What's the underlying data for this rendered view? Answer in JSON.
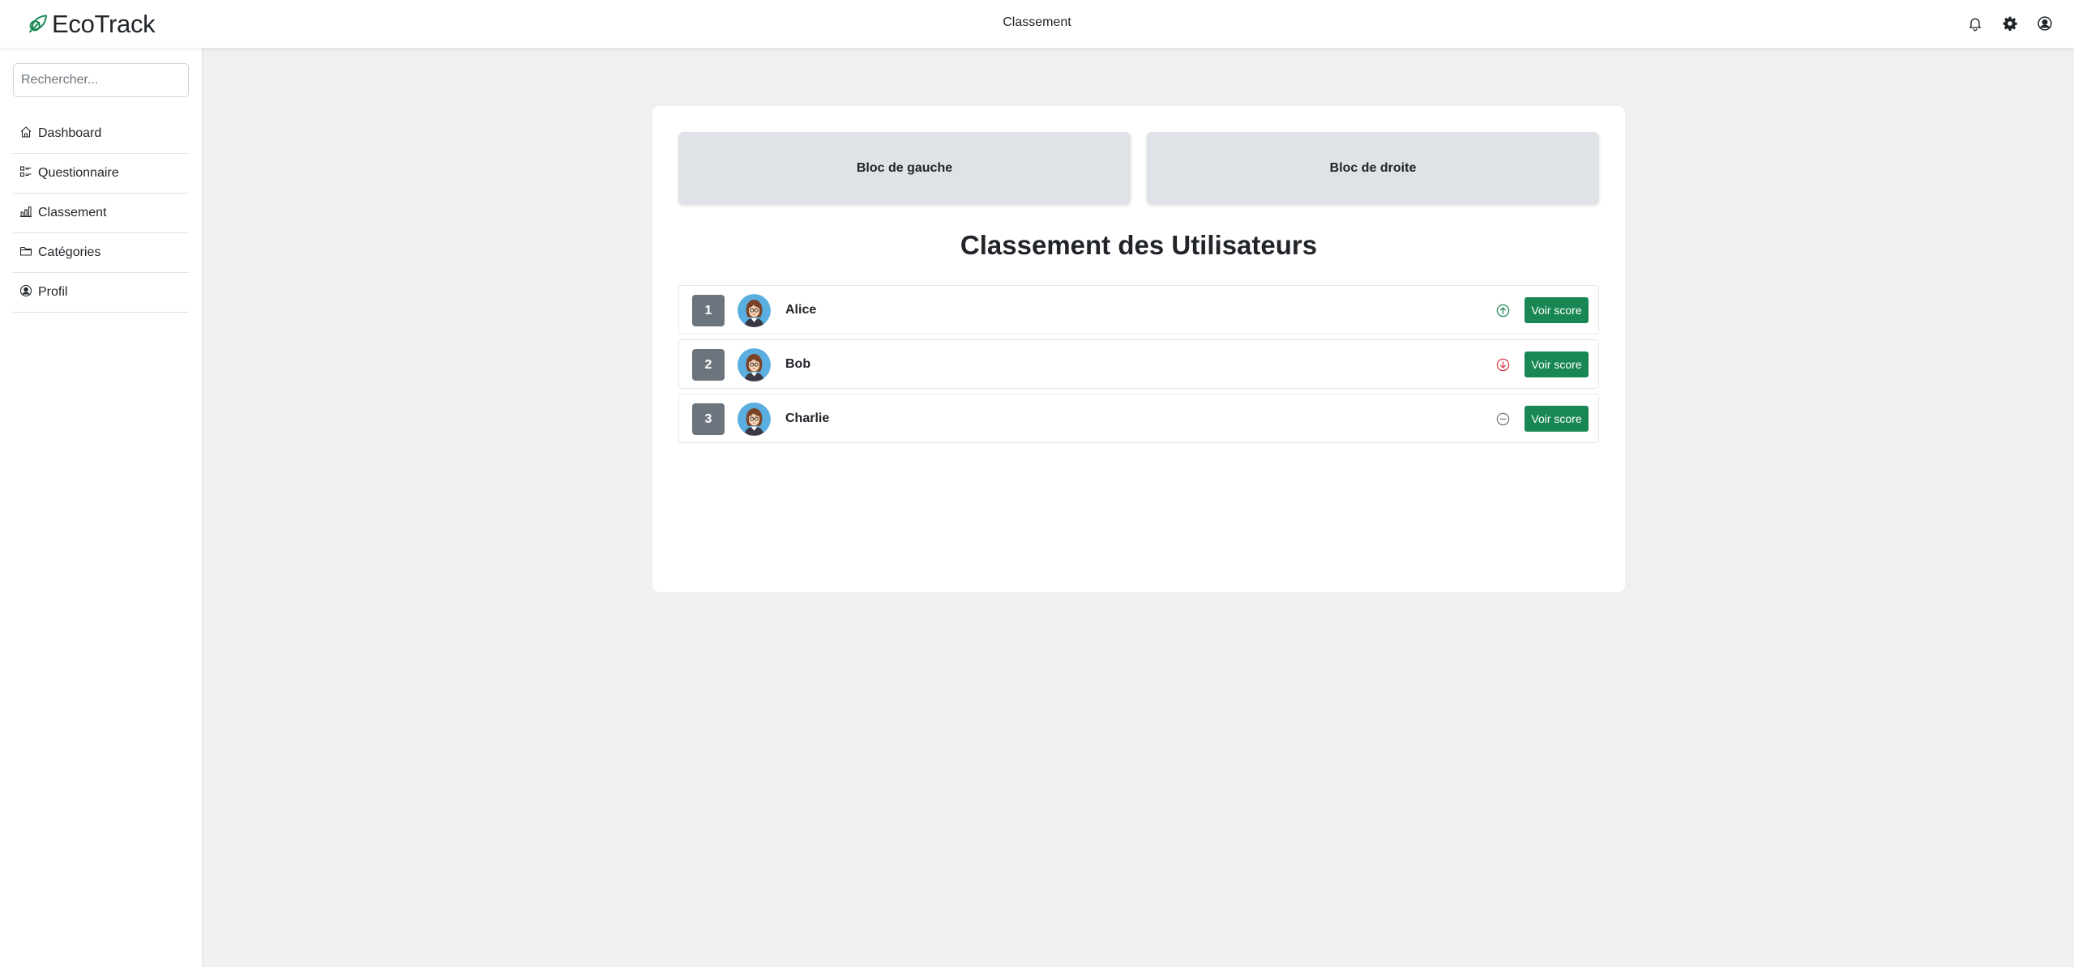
{
  "header": {
    "brand": "EcoTrack",
    "page_title": "Classement",
    "colors": {
      "brand_accent": "#198754"
    },
    "icons": [
      "leaf-icon",
      "bell-icon",
      "gear-icon",
      "user-circle-icon"
    ]
  },
  "sidebar": {
    "search_placeholder": "Rechercher...",
    "items": [
      {
        "label": "Dashboard",
        "icon": "house-icon"
      },
      {
        "label": "Questionnaire",
        "icon": "list-check-icon"
      },
      {
        "label": "Classement",
        "icon": "bar-chart-icon"
      },
      {
        "label": "Catégories",
        "icon": "folder-icon"
      },
      {
        "label": "Profil",
        "icon": "person-circle-icon"
      }
    ]
  },
  "main": {
    "left_block": "Bloc de gauche",
    "right_block": "Bloc de droite",
    "heading": "Classement des Utilisateurs",
    "ranking": [
      {
        "rank": "1",
        "name": "Alice",
        "trend": "up",
        "trend_color": "#198754",
        "button": "Voir score"
      },
      {
        "rank": "2",
        "name": "Bob",
        "trend": "down",
        "trend_color": "#dc3545",
        "button": "Voir score"
      },
      {
        "rank": "3",
        "name": "Charlie",
        "trend": "neutral",
        "trend_color": "#6c757d",
        "button": "Voir score"
      }
    ],
    "button_color": "#198754"
  }
}
